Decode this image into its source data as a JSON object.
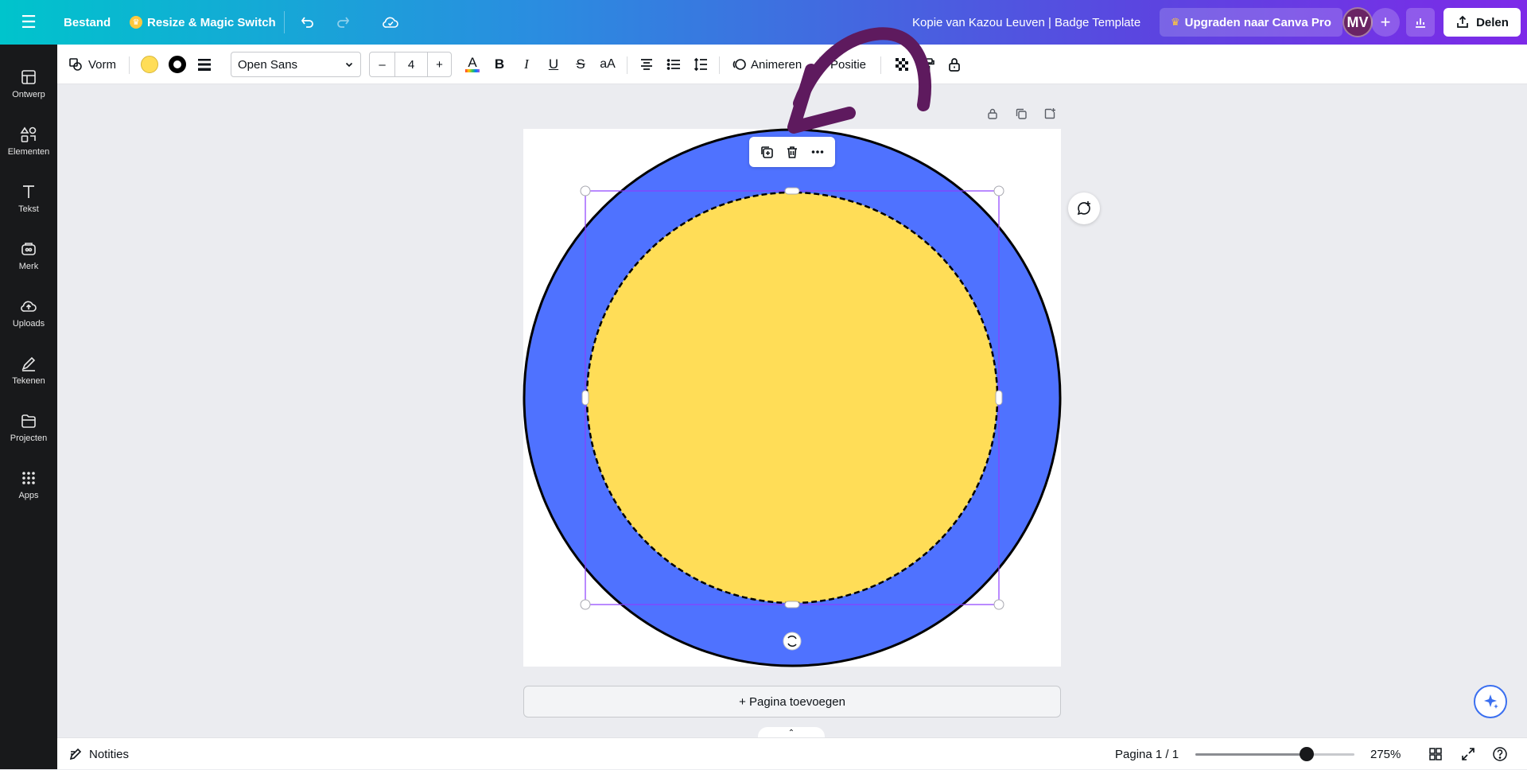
{
  "topbar": {
    "file_label": "Bestand",
    "resize_label": "Resize & Magic Switch",
    "doc_title": "Kopie van Kazou Leuven | Badge Template",
    "upgrade_label": "Upgraden naar Canva Pro",
    "avatar_initials": "MV",
    "share_label": "Delen"
  },
  "sidebar": {
    "items": [
      {
        "label": "Ontwerp",
        "icon": "layout-icon"
      },
      {
        "label": "Elementen",
        "icon": "shapes-icon"
      },
      {
        "label": "Tekst",
        "icon": "text-icon"
      },
      {
        "label": "Merk",
        "icon": "brand-icon"
      },
      {
        "label": "Uploads",
        "icon": "cloud-upload-icon"
      },
      {
        "label": "Tekenen",
        "icon": "pen-icon"
      },
      {
        "label": "Projecten",
        "icon": "folder-icon"
      },
      {
        "label": "Apps",
        "icon": "apps-grid-icon"
      }
    ]
  },
  "toolbar": {
    "shape_label": "Vorm",
    "fill_color": "#ffdd57",
    "font_name": "Open Sans",
    "font_size": "4",
    "minus_label": "–",
    "plus_label": "+",
    "animate_label": "Animeren",
    "position_label": "Positie"
  },
  "canvas": {
    "outer_circle_color": "#4f72ff",
    "inner_circle_color": "#ffdd57",
    "annotation_arrow_color": "#5e1a5e",
    "add_page_label": "+ Pagina toevoegen"
  },
  "bottombar": {
    "notes_label": "Notities",
    "page_indicator": "Pagina 1 / 1",
    "zoom_label": "275%",
    "zoom_slider_fraction": 0.7
  }
}
